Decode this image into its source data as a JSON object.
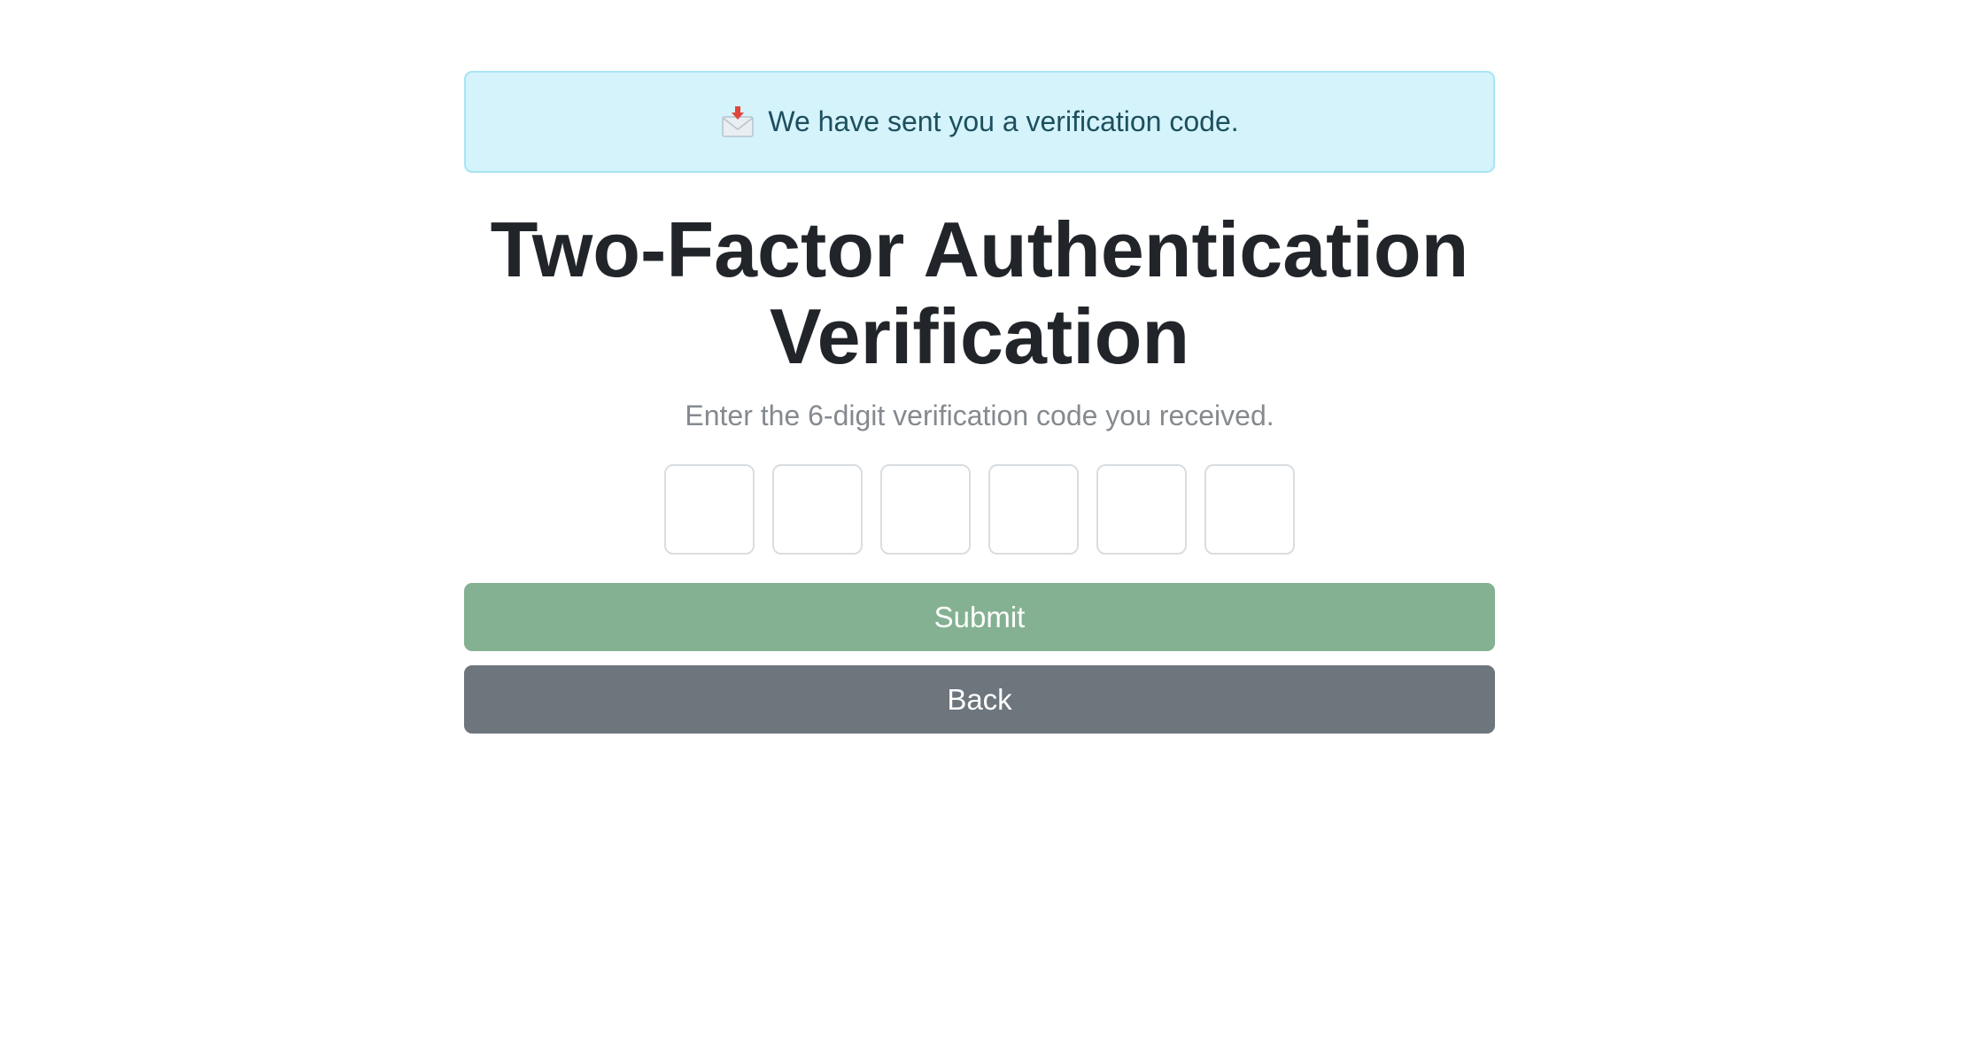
{
  "alert": {
    "icon": "envelope-with-arrow-icon",
    "message": "We have sent you a verification code."
  },
  "heading": {
    "title": "Two-Factor Authentication Verification",
    "subtitle": "Enter the 6-digit verification code you received."
  },
  "code_inputs": [
    {
      "value": ""
    },
    {
      "value": ""
    },
    {
      "value": ""
    },
    {
      "value": ""
    },
    {
      "value": ""
    },
    {
      "value": ""
    }
  ],
  "actions": {
    "submit_label": "Submit",
    "back_label": "Back"
  },
  "colors": {
    "alert_background": "#d4f3fb",
    "alert_border": "#a8e4f3",
    "alert_text": "#1d4f5e",
    "submit_button": "#84b192",
    "back_button": "#6d757d",
    "subtitle_text": "#858a8f"
  }
}
